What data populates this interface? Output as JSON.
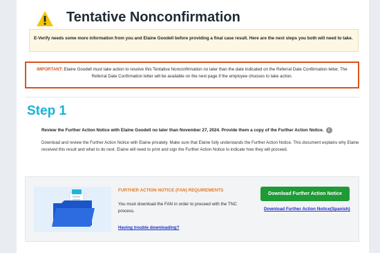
{
  "header": {
    "title": "Tentative Nonconfirmation",
    "icon": "warning-triangle-icon",
    "icon_color": "#f5c400"
  },
  "info_box": {
    "text": "E-Verify needs some more information from you and Elaine Goodell before providing a final case result. Here are the next steps you both will need to take."
  },
  "important_box": {
    "label": "IMPORTANT:",
    "text": "Elaine Goodell must take action to resolve this Tentative Nonconfirmation no later than the date indicated on the Referral Date Confirmation letter. The Referral Date Confirmation letter will be available on the next page if the employee chooses to take action.",
    "border_color": "#d9521d"
  },
  "step": {
    "title": "Step 1",
    "lead": "Review the Further Action Notice with Elaine Goodell no later than November 27, 2024. Provide them a copy of the Further Action Notice.",
    "info_icon": "i",
    "description": "Download and review the Further Action Notice with Elaine privately. Make sure that Elaine fully understands the Further Action Notice. This document explains why Elaine received this result and what to do next. Elaine will need to print and sign the Further Action Notice to indicate how they will proceed.",
    "title_color": "#18b2d6"
  },
  "fan": {
    "heading": "FURTHER ACTION NOTICE (FAN) REQUIREMENTS",
    "text": "You must download the FAN in order to proceed with the TNC process.",
    "help_link": "Having trouble downloading?",
    "download_button": "Download Further Action Notice",
    "spanish_link": "Download Further Action Notice(Spanish)",
    "image_icon": "document-folder-icon",
    "button_color": "#1e9a36",
    "heading_color": "#e07a22"
  }
}
